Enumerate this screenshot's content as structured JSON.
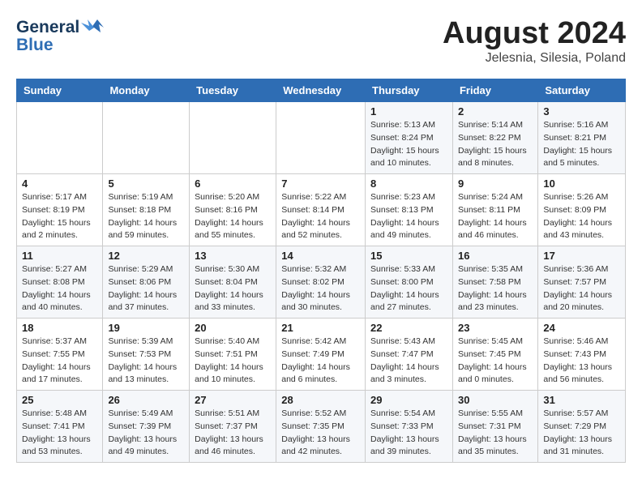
{
  "header": {
    "logo_line1": "General",
    "logo_line2": "Blue",
    "month_year": "August 2024",
    "location": "Jelesnia, Silesia, Poland"
  },
  "days_of_week": [
    "Sunday",
    "Monday",
    "Tuesday",
    "Wednesday",
    "Thursday",
    "Friday",
    "Saturday"
  ],
  "weeks": [
    [
      {
        "day": "",
        "info": ""
      },
      {
        "day": "",
        "info": ""
      },
      {
        "day": "",
        "info": ""
      },
      {
        "day": "",
        "info": ""
      },
      {
        "day": "1",
        "info": "Sunrise: 5:13 AM\nSunset: 8:24 PM\nDaylight: 15 hours\nand 10 minutes."
      },
      {
        "day": "2",
        "info": "Sunrise: 5:14 AM\nSunset: 8:22 PM\nDaylight: 15 hours\nand 8 minutes."
      },
      {
        "day": "3",
        "info": "Sunrise: 5:16 AM\nSunset: 8:21 PM\nDaylight: 15 hours\nand 5 minutes."
      }
    ],
    [
      {
        "day": "4",
        "info": "Sunrise: 5:17 AM\nSunset: 8:19 PM\nDaylight: 15 hours\nand 2 minutes."
      },
      {
        "day": "5",
        "info": "Sunrise: 5:19 AM\nSunset: 8:18 PM\nDaylight: 14 hours\nand 59 minutes."
      },
      {
        "day": "6",
        "info": "Sunrise: 5:20 AM\nSunset: 8:16 PM\nDaylight: 14 hours\nand 55 minutes."
      },
      {
        "day": "7",
        "info": "Sunrise: 5:22 AM\nSunset: 8:14 PM\nDaylight: 14 hours\nand 52 minutes."
      },
      {
        "day": "8",
        "info": "Sunrise: 5:23 AM\nSunset: 8:13 PM\nDaylight: 14 hours\nand 49 minutes."
      },
      {
        "day": "9",
        "info": "Sunrise: 5:24 AM\nSunset: 8:11 PM\nDaylight: 14 hours\nand 46 minutes."
      },
      {
        "day": "10",
        "info": "Sunrise: 5:26 AM\nSunset: 8:09 PM\nDaylight: 14 hours\nand 43 minutes."
      }
    ],
    [
      {
        "day": "11",
        "info": "Sunrise: 5:27 AM\nSunset: 8:08 PM\nDaylight: 14 hours\nand 40 minutes."
      },
      {
        "day": "12",
        "info": "Sunrise: 5:29 AM\nSunset: 8:06 PM\nDaylight: 14 hours\nand 37 minutes."
      },
      {
        "day": "13",
        "info": "Sunrise: 5:30 AM\nSunset: 8:04 PM\nDaylight: 14 hours\nand 33 minutes."
      },
      {
        "day": "14",
        "info": "Sunrise: 5:32 AM\nSunset: 8:02 PM\nDaylight: 14 hours\nand 30 minutes."
      },
      {
        "day": "15",
        "info": "Sunrise: 5:33 AM\nSunset: 8:00 PM\nDaylight: 14 hours\nand 27 minutes."
      },
      {
        "day": "16",
        "info": "Sunrise: 5:35 AM\nSunset: 7:58 PM\nDaylight: 14 hours\nand 23 minutes."
      },
      {
        "day": "17",
        "info": "Sunrise: 5:36 AM\nSunset: 7:57 PM\nDaylight: 14 hours\nand 20 minutes."
      }
    ],
    [
      {
        "day": "18",
        "info": "Sunrise: 5:37 AM\nSunset: 7:55 PM\nDaylight: 14 hours\nand 17 minutes."
      },
      {
        "day": "19",
        "info": "Sunrise: 5:39 AM\nSunset: 7:53 PM\nDaylight: 14 hours\nand 13 minutes."
      },
      {
        "day": "20",
        "info": "Sunrise: 5:40 AM\nSunset: 7:51 PM\nDaylight: 14 hours\nand 10 minutes."
      },
      {
        "day": "21",
        "info": "Sunrise: 5:42 AM\nSunset: 7:49 PM\nDaylight: 14 hours\nand 6 minutes."
      },
      {
        "day": "22",
        "info": "Sunrise: 5:43 AM\nSunset: 7:47 PM\nDaylight: 14 hours\nand 3 minutes."
      },
      {
        "day": "23",
        "info": "Sunrise: 5:45 AM\nSunset: 7:45 PM\nDaylight: 14 hours\nand 0 minutes."
      },
      {
        "day": "24",
        "info": "Sunrise: 5:46 AM\nSunset: 7:43 PM\nDaylight: 13 hours\nand 56 minutes."
      }
    ],
    [
      {
        "day": "25",
        "info": "Sunrise: 5:48 AM\nSunset: 7:41 PM\nDaylight: 13 hours\nand 53 minutes."
      },
      {
        "day": "26",
        "info": "Sunrise: 5:49 AM\nSunset: 7:39 PM\nDaylight: 13 hours\nand 49 minutes."
      },
      {
        "day": "27",
        "info": "Sunrise: 5:51 AM\nSunset: 7:37 PM\nDaylight: 13 hours\nand 46 minutes."
      },
      {
        "day": "28",
        "info": "Sunrise: 5:52 AM\nSunset: 7:35 PM\nDaylight: 13 hours\nand 42 minutes."
      },
      {
        "day": "29",
        "info": "Sunrise: 5:54 AM\nSunset: 7:33 PM\nDaylight: 13 hours\nand 39 minutes."
      },
      {
        "day": "30",
        "info": "Sunrise: 5:55 AM\nSunset: 7:31 PM\nDaylight: 13 hours\nand 35 minutes."
      },
      {
        "day": "31",
        "info": "Sunrise: 5:57 AM\nSunset: 7:29 PM\nDaylight: 13 hours\nand 31 minutes."
      }
    ]
  ]
}
